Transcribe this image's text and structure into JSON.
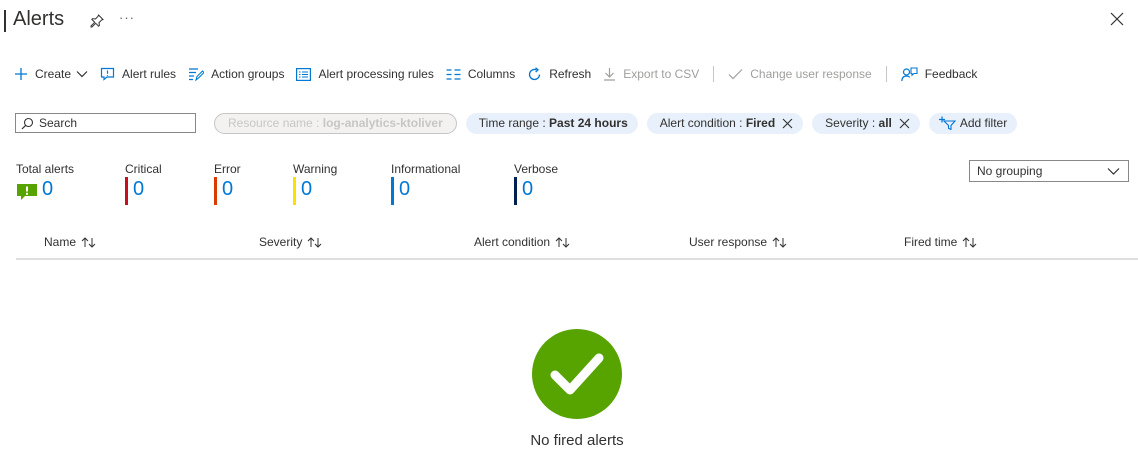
{
  "header": {
    "title": "Alerts",
    "more_label": "···"
  },
  "toolbar": {
    "create": "Create",
    "alert_rules": "Alert rules",
    "action_groups": "Action groups",
    "alert_processing_rules": "Alert processing rules",
    "columns": "Columns",
    "refresh": "Refresh",
    "export_csv": "Export to CSV",
    "change_user_response": "Change user response",
    "feedback": "Feedback"
  },
  "filters": {
    "search_placeholder": "Search",
    "resource_name_label": "Resource name : ",
    "resource_name_value": "log-analytics-ktoliver",
    "time_range_label": "Time range : ",
    "time_range_value": "Past 24 hours",
    "alert_condition_label": "Alert condition : ",
    "alert_condition_value": "Fired",
    "severity_label": "Severity : ",
    "severity_value": "all",
    "add_filter": "Add filter"
  },
  "summary": {
    "total": {
      "label": "Total alerts",
      "value": "0"
    },
    "critical": {
      "label": "Critical",
      "value": "0",
      "color": "#c50f1f"
    },
    "error": {
      "label": "Error",
      "value": "0",
      "color": "#da3b01"
    },
    "warning": {
      "label": "Warning",
      "value": "0",
      "color": "#fce100"
    },
    "informational": {
      "label": "Informational",
      "value": "0",
      "color": "#0078d4"
    },
    "verbose": {
      "label": "Verbose",
      "value": "0",
      "color": "#002050"
    }
  },
  "grouping": {
    "selected": "No grouping"
  },
  "table": {
    "columns": [
      "Name",
      "Severity",
      "Alert condition",
      "User response",
      "Fired time"
    ]
  },
  "empty_state": {
    "message": "No fired alerts",
    "icon": "check-circle-icon",
    "color": "#57a300"
  },
  "colors": {
    "accent": "#0078d4",
    "pill_bg": "#e8f1fb",
    "total_icon": "#57a300"
  }
}
